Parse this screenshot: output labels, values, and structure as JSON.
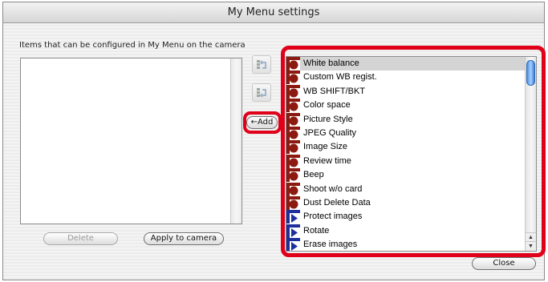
{
  "window": {
    "title": "My Menu settings"
  },
  "caption": "Items that can be configured in My Menu on the camera",
  "buttons": {
    "delete": "Delete",
    "apply": "Apply to camera",
    "add": "←Add",
    "close": "Close"
  },
  "items": [
    {
      "label": "White balance",
      "icon": "camera-red-icon",
      "selected": true
    },
    {
      "label": "Custom WB regist.",
      "icon": "camera-red-icon",
      "selected": false
    },
    {
      "label": "WB SHIFT/BKT",
      "icon": "camera-red-icon",
      "selected": false
    },
    {
      "label": "Color space",
      "icon": "camera-red-icon",
      "selected": false
    },
    {
      "label": "Picture Style",
      "icon": "camera-red-icon",
      "selected": false
    },
    {
      "label": "JPEG Quality",
      "icon": "camera-red-icon",
      "selected": false
    },
    {
      "label": "Image Size",
      "icon": "camera-red-icon",
      "selected": false
    },
    {
      "label": "Review time",
      "icon": "camera-red-icon",
      "selected": false
    },
    {
      "label": "Beep",
      "icon": "camera-red-icon",
      "selected": false
    },
    {
      "label": "Shoot w/o card",
      "icon": "camera-red-icon",
      "selected": false
    },
    {
      "label": "Dust Delete Data",
      "icon": "camera-red-icon",
      "selected": false
    },
    {
      "label": "Protect images",
      "icon": "playback-blue-icon",
      "selected": false
    },
    {
      "label": "Rotate",
      "icon": "playback-blue-icon",
      "selected": false
    },
    {
      "label": "Erase images",
      "icon": "playback-blue-icon",
      "selected": false
    }
  ],
  "colors": {
    "highlight": "#e0001a",
    "shoot_icon": "#8b1a10",
    "play_icon": "#1e2f9c",
    "selected_row": "#d4d4d4"
  }
}
